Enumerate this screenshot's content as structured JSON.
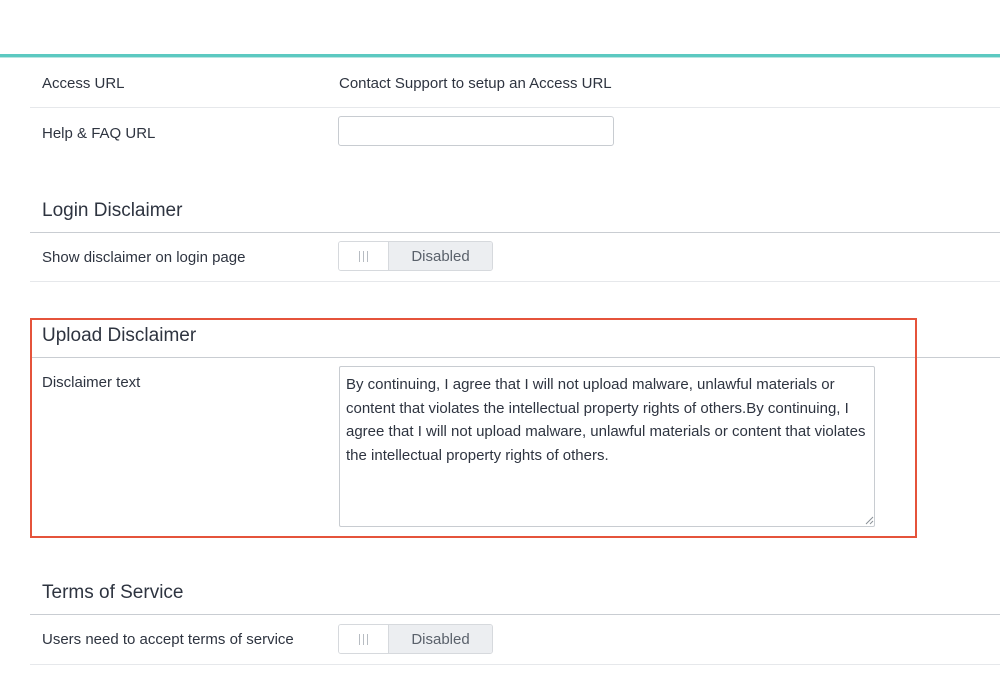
{
  "general": {
    "access_url_label": "Access URL",
    "access_url_value": "Contact Support to setup an Access URL",
    "help_faq_label": "Help & FAQ URL",
    "help_faq_value": ""
  },
  "login_disclaimer": {
    "heading": "Login Disclaimer",
    "show_label": "Show disclaimer on login page",
    "toggle_state": "Disabled"
  },
  "upload_disclaimer": {
    "heading": "Upload Disclaimer",
    "text_label": "Disclaimer text",
    "text_value": "By continuing, I agree that I will not upload malware, unlawful materials or content that violates the intellectual property rights of others.By continuing, I agree that I will not upload malware, unlawful materials or content that violates the intellectual property rights of others."
  },
  "terms_of_service": {
    "heading": "Terms of Service",
    "accept_label": "Users need to accept terms of service",
    "toggle_state": "Disabled"
  },
  "colors": {
    "accent": "#5cc9c1",
    "highlight": "#e5533b"
  }
}
